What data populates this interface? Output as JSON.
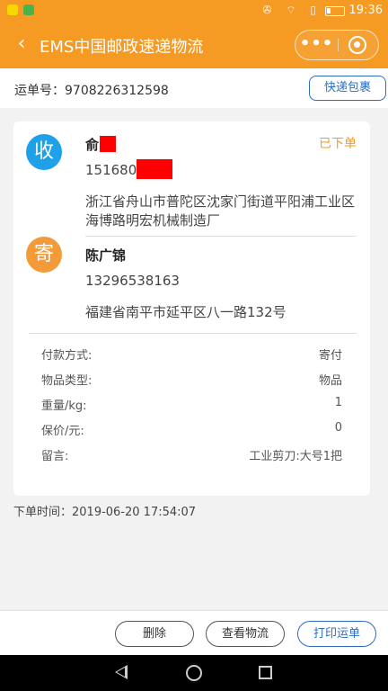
{
  "nav": {
    "title": "EMS中国邮政速递物流",
    "back_icon": "‹",
    "more_label": "•••"
  },
  "status_bar": {
    "time": "19:36",
    "sys_icons": "✇ ⌔ ▯"
  },
  "waybill": {
    "label": "运单号：9708226312598",
    "express_button": "快递包裹"
  },
  "receiver": {
    "badge": "收",
    "name": "俞",
    "phone": "1516807",
    "address": "浙江省舟山市普陀区沈家门街道平阳浦工业区海博路明宏机械制造厂",
    "status": "已下单"
  },
  "sender": {
    "badge": "寄",
    "name": "陈广锦",
    "phone": "13296538163",
    "address": "福建省南平市延平区八一路132号"
  },
  "details": [
    {
      "label": "付款方式:",
      "value": "寄付"
    },
    {
      "label": "物品类型:",
      "value": "物品"
    },
    {
      "label": "重量/kg:",
      "value": "1"
    },
    {
      "label": "保价/元:",
      "value": "0"
    },
    {
      "label": "留言:",
      "value": "工业剪刀:大号1把"
    }
  ],
  "order_time": "下单时间：2019-06-20 17:54:07",
  "actions": {
    "delete": "删除",
    "track": "查看物流",
    "print": "打印运单"
  },
  "colors": {
    "accent": "#f59a23",
    "link_blue": "#2d6ec1",
    "receive_icon": "#1ea1e8",
    "send_icon": "#f29b38",
    "redaction": "#ff0000"
  }
}
